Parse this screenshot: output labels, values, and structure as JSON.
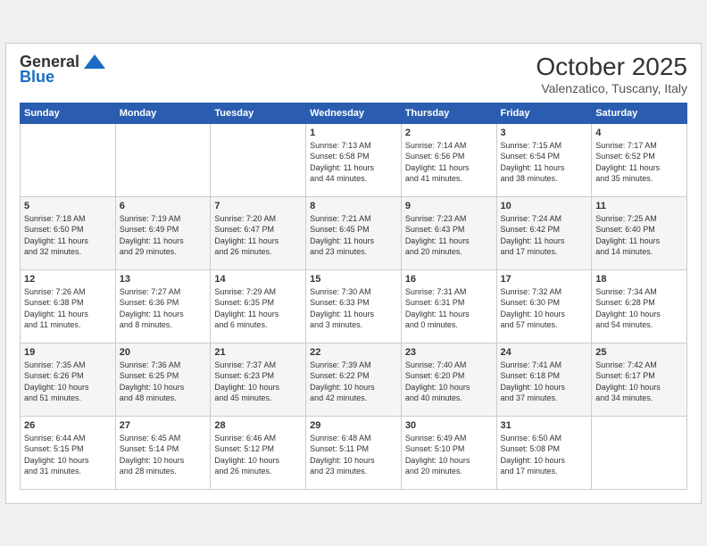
{
  "header": {
    "logo_general": "General",
    "logo_blue": "Blue",
    "month": "October 2025",
    "location": "Valenzatico, Tuscany, Italy"
  },
  "weekdays": [
    "Sunday",
    "Monday",
    "Tuesday",
    "Wednesday",
    "Thursday",
    "Friday",
    "Saturday"
  ],
  "weeks": [
    [
      {
        "day": "",
        "info": ""
      },
      {
        "day": "",
        "info": ""
      },
      {
        "day": "",
        "info": ""
      },
      {
        "day": "1",
        "info": "Sunrise: 7:13 AM\nSunset: 6:58 PM\nDaylight: 11 hours\nand 44 minutes."
      },
      {
        "day": "2",
        "info": "Sunrise: 7:14 AM\nSunset: 6:56 PM\nDaylight: 11 hours\nand 41 minutes."
      },
      {
        "day": "3",
        "info": "Sunrise: 7:15 AM\nSunset: 6:54 PM\nDaylight: 11 hours\nand 38 minutes."
      },
      {
        "day": "4",
        "info": "Sunrise: 7:17 AM\nSunset: 6:52 PM\nDaylight: 11 hours\nand 35 minutes."
      }
    ],
    [
      {
        "day": "5",
        "info": "Sunrise: 7:18 AM\nSunset: 6:50 PM\nDaylight: 11 hours\nand 32 minutes."
      },
      {
        "day": "6",
        "info": "Sunrise: 7:19 AM\nSunset: 6:49 PM\nDaylight: 11 hours\nand 29 minutes."
      },
      {
        "day": "7",
        "info": "Sunrise: 7:20 AM\nSunset: 6:47 PM\nDaylight: 11 hours\nand 26 minutes."
      },
      {
        "day": "8",
        "info": "Sunrise: 7:21 AM\nSunset: 6:45 PM\nDaylight: 11 hours\nand 23 minutes."
      },
      {
        "day": "9",
        "info": "Sunrise: 7:23 AM\nSunset: 6:43 PM\nDaylight: 11 hours\nand 20 minutes."
      },
      {
        "day": "10",
        "info": "Sunrise: 7:24 AM\nSunset: 6:42 PM\nDaylight: 11 hours\nand 17 minutes."
      },
      {
        "day": "11",
        "info": "Sunrise: 7:25 AM\nSunset: 6:40 PM\nDaylight: 11 hours\nand 14 minutes."
      }
    ],
    [
      {
        "day": "12",
        "info": "Sunrise: 7:26 AM\nSunset: 6:38 PM\nDaylight: 11 hours\nand 11 minutes."
      },
      {
        "day": "13",
        "info": "Sunrise: 7:27 AM\nSunset: 6:36 PM\nDaylight: 11 hours\nand 8 minutes."
      },
      {
        "day": "14",
        "info": "Sunrise: 7:29 AM\nSunset: 6:35 PM\nDaylight: 11 hours\nand 6 minutes."
      },
      {
        "day": "15",
        "info": "Sunrise: 7:30 AM\nSunset: 6:33 PM\nDaylight: 11 hours\nand 3 minutes."
      },
      {
        "day": "16",
        "info": "Sunrise: 7:31 AM\nSunset: 6:31 PM\nDaylight: 11 hours\nand 0 minutes."
      },
      {
        "day": "17",
        "info": "Sunrise: 7:32 AM\nSunset: 6:30 PM\nDaylight: 10 hours\nand 57 minutes."
      },
      {
        "day": "18",
        "info": "Sunrise: 7:34 AM\nSunset: 6:28 PM\nDaylight: 10 hours\nand 54 minutes."
      }
    ],
    [
      {
        "day": "19",
        "info": "Sunrise: 7:35 AM\nSunset: 6:26 PM\nDaylight: 10 hours\nand 51 minutes."
      },
      {
        "day": "20",
        "info": "Sunrise: 7:36 AM\nSunset: 6:25 PM\nDaylight: 10 hours\nand 48 minutes."
      },
      {
        "day": "21",
        "info": "Sunrise: 7:37 AM\nSunset: 6:23 PM\nDaylight: 10 hours\nand 45 minutes."
      },
      {
        "day": "22",
        "info": "Sunrise: 7:39 AM\nSunset: 6:22 PM\nDaylight: 10 hours\nand 42 minutes."
      },
      {
        "day": "23",
        "info": "Sunrise: 7:40 AM\nSunset: 6:20 PM\nDaylight: 10 hours\nand 40 minutes."
      },
      {
        "day": "24",
        "info": "Sunrise: 7:41 AM\nSunset: 6:18 PM\nDaylight: 10 hours\nand 37 minutes."
      },
      {
        "day": "25",
        "info": "Sunrise: 7:42 AM\nSunset: 6:17 PM\nDaylight: 10 hours\nand 34 minutes."
      }
    ],
    [
      {
        "day": "26",
        "info": "Sunrise: 6:44 AM\nSunset: 5:15 PM\nDaylight: 10 hours\nand 31 minutes."
      },
      {
        "day": "27",
        "info": "Sunrise: 6:45 AM\nSunset: 5:14 PM\nDaylight: 10 hours\nand 28 minutes."
      },
      {
        "day": "28",
        "info": "Sunrise: 6:46 AM\nSunset: 5:12 PM\nDaylight: 10 hours\nand 26 minutes."
      },
      {
        "day": "29",
        "info": "Sunrise: 6:48 AM\nSunset: 5:11 PM\nDaylight: 10 hours\nand 23 minutes."
      },
      {
        "day": "30",
        "info": "Sunrise: 6:49 AM\nSunset: 5:10 PM\nDaylight: 10 hours\nand 20 minutes."
      },
      {
        "day": "31",
        "info": "Sunrise: 6:50 AM\nSunset: 5:08 PM\nDaylight: 10 hours\nand 17 minutes."
      },
      {
        "day": "",
        "info": ""
      }
    ]
  ]
}
